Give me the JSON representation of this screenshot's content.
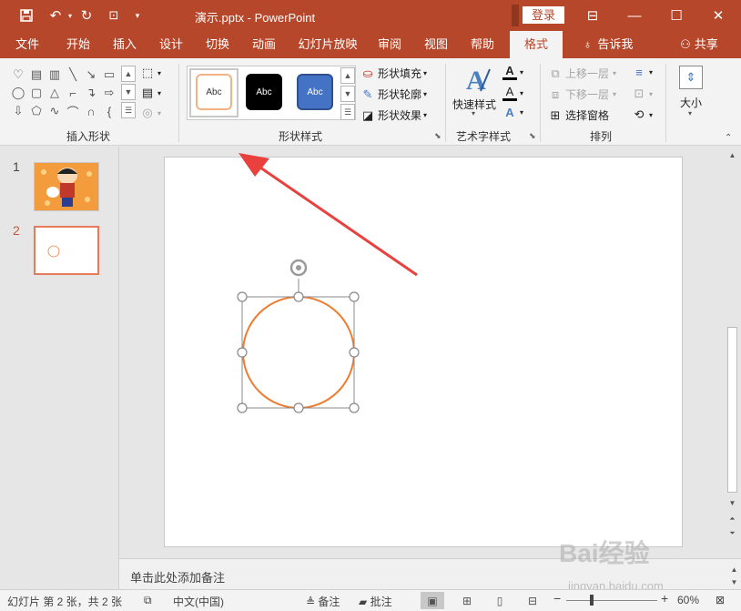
{
  "title": "演示.pptx  -  PowerPoint",
  "login_label": "登录",
  "tabs": [
    {
      "label": "文件"
    },
    {
      "label": "开始"
    },
    {
      "label": "插入"
    },
    {
      "label": "设计"
    },
    {
      "label": "切换"
    },
    {
      "label": "动画"
    },
    {
      "label": "幻灯片放映"
    },
    {
      "label": "审阅"
    },
    {
      "label": "视图"
    },
    {
      "label": "帮助"
    },
    {
      "label": "格式"
    }
  ],
  "tell_me": "告诉我",
  "share": "共享",
  "ribbon": {
    "insert_shapes_label": "插入形状",
    "shape_styles_label": "形状样式",
    "style_swatches": [
      "Abc",
      "Abc",
      "Abc"
    ],
    "shape_fill": "形状填充",
    "shape_outline": "形状轮廓",
    "shape_effects": "形状效果",
    "quick_styles": "快速样式",
    "wordart_label": "艺术字样式",
    "bring_forward": "上移一层",
    "send_backward": "下移一层",
    "selection_pane": "选择窗格",
    "arrange_label": "排列",
    "size_label": "大小"
  },
  "thumbnails": [
    {
      "number": "1"
    },
    {
      "number": "2"
    }
  ],
  "notes_placeholder": "单击此处添加备注",
  "status": {
    "slide_info": "幻灯片 第 2 张，共 2 张",
    "language": "中文(中国)",
    "notes": "备注",
    "comments": "批注",
    "zoom": "60%"
  },
  "watermark": {
    "text": "Bai经验",
    "sub": "jingyan.baidu.com"
  },
  "colors": {
    "accent": "#b7472a",
    "shape_outline": "#ed7d31",
    "arrow": "#e8413e"
  }
}
